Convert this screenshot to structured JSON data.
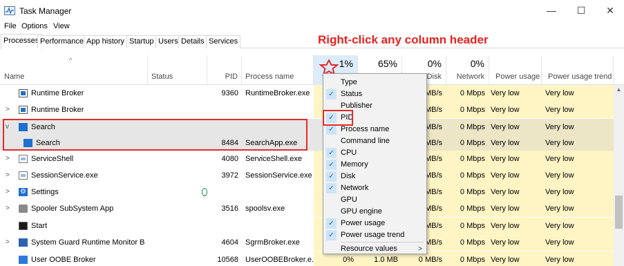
{
  "window": {
    "title": "Task Manager",
    "minimize": "—",
    "maximize": "☐",
    "close": "✕"
  },
  "menu": [
    "File",
    "Options",
    "View"
  ],
  "tabs": [
    "Processes",
    "Performance",
    "App history",
    "Startup",
    "Users",
    "Details",
    "Services"
  ],
  "annotation": "Right-click any column header",
  "header": {
    "name": "Name",
    "status": "Status",
    "pid": "PID",
    "process_name": "Process name",
    "cpu_pct": "1%",
    "memory_pct": "65%",
    "disk_pct": "0%",
    "disk": "Disk",
    "network_pct": "0%",
    "network": "Network",
    "power": "Power usage",
    "power_trend": "Power usage trend"
  },
  "rows": [
    {
      "name": "Runtime Broker",
      "pid": "9360",
      "proc": "RuntimeBroker.exe",
      "disk": "MB/s",
      "net": "0 Mbps",
      "power": "Very low",
      "trend": "Very low"
    },
    {
      "name": "Runtime Broker",
      "pid": "",
      "proc": "",
      "disk": "MB/s",
      "net": "0 Mbps",
      "power": "Very low",
      "trend": "Very low"
    },
    {
      "name": "Search",
      "pid": "",
      "proc": "",
      "disk": "MB/s",
      "net": "0 Mbps",
      "power": "Very low",
      "trend": "Very low"
    },
    {
      "name": "Search",
      "pid": "8484",
      "proc": "SearchApp.exe",
      "disk": "MB/s",
      "net": "0 Mbps",
      "power": "Very low",
      "trend": "Very low"
    },
    {
      "name": "ServiceShell",
      "pid": "4080",
      "proc": "ServiceShell.exe",
      "disk": "MB/s",
      "net": "0 Mbps",
      "power": "Very low",
      "trend": "Very low"
    },
    {
      "name": "SessionService.exe",
      "pid": "3972",
      "proc": "SessionService.exe",
      "disk": "MB/s",
      "net": "0 Mbps",
      "power": "Very low",
      "trend": "Very low"
    },
    {
      "name": "Settings",
      "pid": "",
      "proc": "",
      "disk": "MB/s",
      "net": "0 Mbps",
      "power": "Very low",
      "trend": "Very low"
    },
    {
      "name": "Spooler SubSystem App",
      "pid": "3516",
      "proc": "spoolsv.exe",
      "disk": "MB/s",
      "net": "0 Mbps",
      "power": "Very low",
      "trend": "Very low"
    },
    {
      "name": "Start",
      "pid": "",
      "proc": "",
      "disk": "MB/s",
      "net": "0 Mbps",
      "power": "Very low",
      "trend": "Very low"
    },
    {
      "name": "System Guard Runtime Monitor B...",
      "pid": "4604",
      "proc": "SgrmBroker.exe",
      "disk": "MB/s",
      "net": "0 Mbps",
      "power": "Very low",
      "trend": "Very low"
    },
    {
      "name": "User OOBE Broker",
      "pid": "10568",
      "proc": "UserOOBEBroker.e...",
      "cpu": "0%",
      "mem": "1.0 MB",
      "disk": "0 MB/s",
      "net": "0 Mbps",
      "power": "Very low",
      "trend": "Very low"
    }
  ],
  "context_menu": [
    {
      "label": "Type",
      "checked": false
    },
    {
      "label": "Status",
      "checked": true
    },
    {
      "label": "Publisher",
      "checked": false
    },
    {
      "label": "PID",
      "checked": true
    },
    {
      "label": "Process name",
      "checked": true
    },
    {
      "label": "Command line",
      "checked": false
    },
    {
      "label": "CPU",
      "checked": true
    },
    {
      "label": "Memory",
      "checked": true
    },
    {
      "label": "Disk",
      "checked": true
    },
    {
      "label": "Network",
      "checked": true
    },
    {
      "label": "GPU",
      "checked": false
    },
    {
      "label": "GPU engine",
      "checked": false
    },
    {
      "label": "Power usage",
      "checked": true
    },
    {
      "label": "Power usage trend",
      "checked": true
    },
    {
      "label": "Resource values",
      "checked": false,
      "submenu": true
    }
  ],
  "colors": {
    "accent": "#e8221d",
    "shade": "#fff4c4",
    "check_bg": "#cde4f7"
  }
}
